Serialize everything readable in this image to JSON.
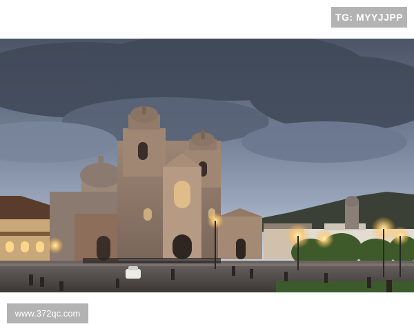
{
  "watermarks": {
    "top_right": "TG: MYYJJPP",
    "bottom_left": "www.372qc.com"
  },
  "photo": {
    "subject": "cathedral-plaza-at-dusk",
    "colors": {
      "sky_top": "#4b5566",
      "sky_mid": "#8290a8",
      "sky_horizon": "#c8d2e0",
      "stone": "#8b7666",
      "stone_light": "#b69a84",
      "lamp_glow": "#ffd27a",
      "ground": "#4e4a48",
      "grass": "#3d5a2c"
    }
  }
}
